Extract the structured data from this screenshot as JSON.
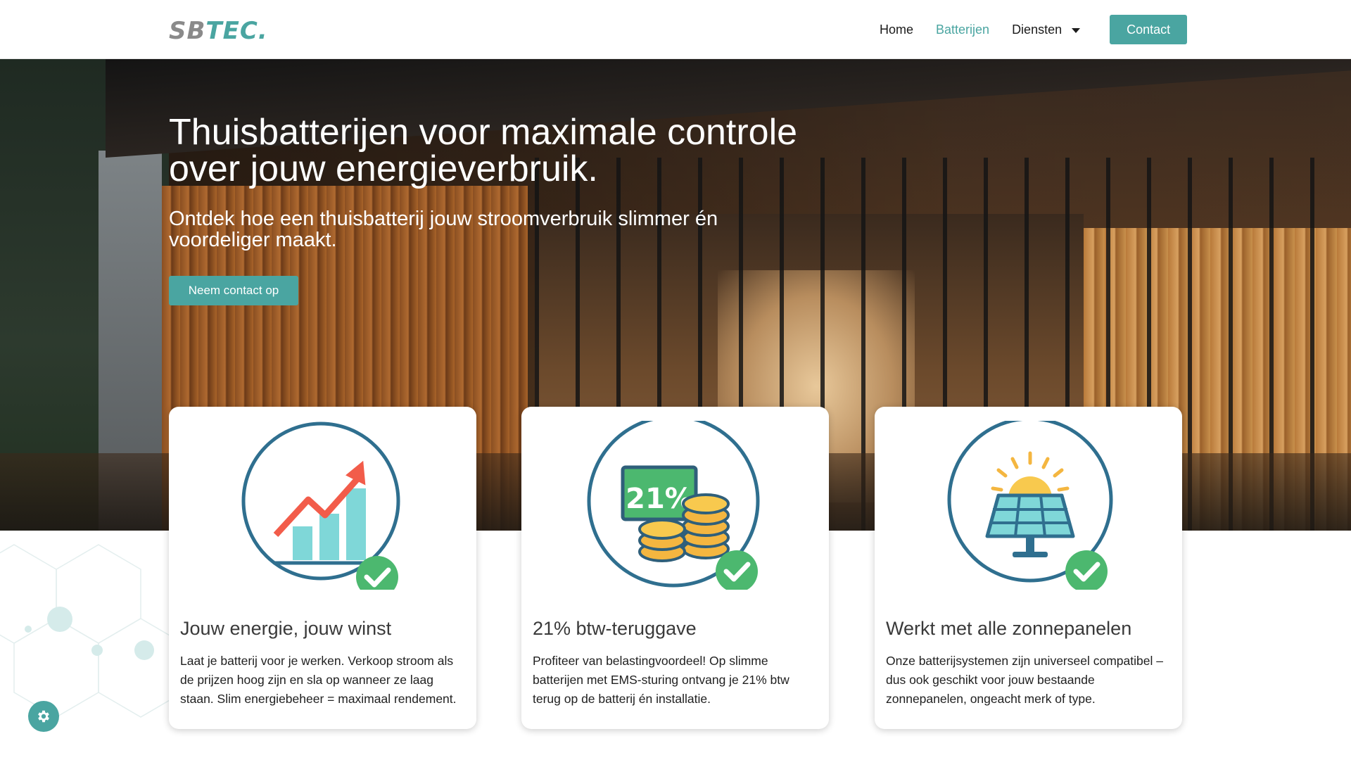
{
  "brand": {
    "logo_part1": "SB",
    "logo_part2": "TEC",
    "logo_dot": "."
  },
  "nav": {
    "home": "Home",
    "batterijen": "Batterijen",
    "diensten": "Diensten",
    "contact": "Contact"
  },
  "colors": {
    "accent": "#4aa5a1",
    "card_ring": "#2f6f8f",
    "check": "#4cb86f"
  },
  "hero": {
    "title": "Thuisbatterijen voor maximale controle over jouw energieverbruik.",
    "subtitle": "Ontdek hoe een thuisbatterij jouw stroomverbruik slimmer én voordeliger maakt.",
    "cta": "Neem contact op"
  },
  "cards": [
    {
      "icon": "growth-chart-icon",
      "title": "Jouw energie, jouw winst",
      "text": "Laat je batterij voor je werken. Verkoop stroom als de prijzen hoog zijn en sla op wanneer ze laag staan. Slim energiebeheer = maximaal rendement."
    },
    {
      "icon": "tax-refund-coins-icon",
      "badge": "21%",
      "title": "21% btw-teruggave",
      "text": "Profiteer van belastingvoordeel! Op slimme batterijen met EMS-sturing ontvang je 21% btw terug op de batterij én installatie."
    },
    {
      "icon": "solar-panel-icon",
      "title": "Werkt met alle zonnepanelen",
      "text": "Onze batterijsystemen zijn universeel compatibel – dus ook geschikt voor jouw bestaande zonnepanelen, ongeacht merk of type."
    }
  ],
  "widgets": {
    "settings_icon": "gear-icon"
  }
}
